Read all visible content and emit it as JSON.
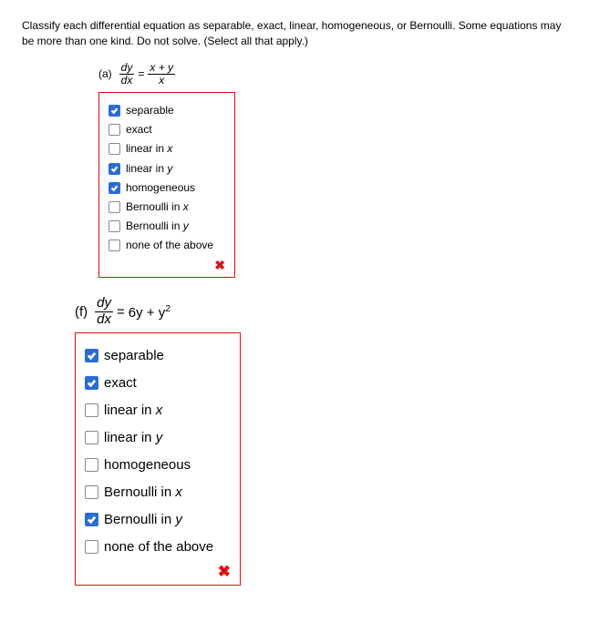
{
  "instructions": "Classify each differential equation as separable, exact, linear, homogeneous, or Bernoulli. Some equations may be more than one kind. Do not solve. (Select all that apply.)",
  "parts": {
    "a": {
      "label": "(a)",
      "equation": {
        "lhs_num": "dy",
        "lhs_den": "dx",
        "op": "=",
        "rhs_num": "x + y",
        "rhs_den": "x"
      },
      "options": [
        {
          "label": "separable",
          "checked": true
        },
        {
          "label": "exact",
          "checked": false
        },
        {
          "label": "linear in x",
          "checked": false
        },
        {
          "label": "linear in y",
          "checked": true
        },
        {
          "label": "homogeneous",
          "checked": true
        },
        {
          "label": "Bernoulli in x",
          "checked": false
        },
        {
          "label": "Bernoulli in y",
          "checked": false
        },
        {
          "label": "none of the above",
          "checked": false
        }
      ],
      "feedback": "incorrect"
    },
    "f": {
      "label": "(f)",
      "equation": {
        "lhs_num": "dy",
        "lhs_den": "dx",
        "op": "=",
        "rhs_text": "6y + y",
        "rhs_sup": "2"
      },
      "options": [
        {
          "label": "separable",
          "checked": true
        },
        {
          "label": "exact",
          "checked": true
        },
        {
          "label": "linear in x",
          "checked": false
        },
        {
          "label": "linear in y",
          "checked": false
        },
        {
          "label": "homogeneous",
          "checked": false
        },
        {
          "label": "Bernoulli in x",
          "checked": false
        },
        {
          "label": "Bernoulli in y",
          "checked": true
        },
        {
          "label": "none of the above",
          "checked": false
        }
      ],
      "feedback": "incorrect"
    }
  }
}
